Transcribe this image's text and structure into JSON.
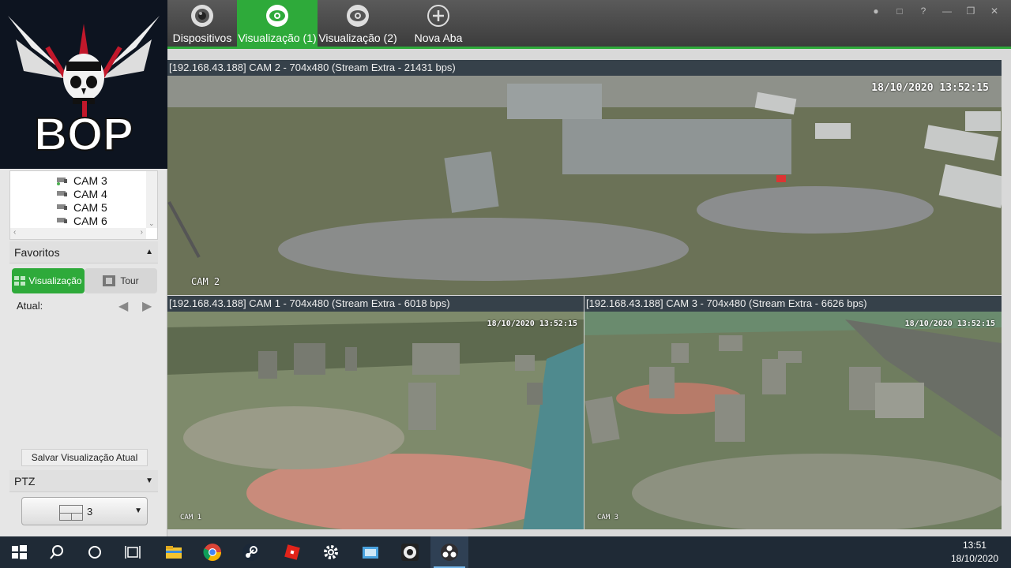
{
  "toolbar": {
    "tabs": [
      {
        "label": "Dispositivos",
        "icon": "camera-lens-icon"
      },
      {
        "label": "Visualização (1)",
        "icon": "eye-icon",
        "active": true
      },
      {
        "label": "Visualização (2)",
        "icon": "eye-icon"
      },
      {
        "label": "Nova Aba",
        "icon": "plus-circle-icon"
      }
    ],
    "window_controls": [
      "user-icon",
      "lock-icon",
      "help-icon",
      "minimize-icon",
      "restore-icon",
      "close-icon"
    ],
    "accent_color": "#2eaa3a"
  },
  "logo": {
    "text": "BOP"
  },
  "device_tree": {
    "items": [
      "CAM 3",
      "CAM 4",
      "CAM 5",
      "CAM 6"
    ]
  },
  "favoritos": {
    "label": "Favoritos",
    "view_button": "Visualização",
    "tour_button": "Tour",
    "current_label": "Atual:",
    "save_button": "Salvar Visualização Atual"
  },
  "ptz": {
    "label": "PTZ"
  },
  "layout_selector": {
    "value": "3"
  },
  "panes": [
    {
      "title": "[192.168.43.188] CAM 2 - 704x480 (Stream Extra - 21431 bps)",
      "osd_date": "18/10/2020  13:52:15",
      "osd_name": "CAM 2"
    },
    {
      "title": "[192.168.43.188] CAM 1 - 704x480 (Stream Extra - 6018 bps)",
      "osd_date": "18/10/2020  13:52:15",
      "osd_name": "CAM 1"
    },
    {
      "title": "[192.168.43.188] CAM 3 - 704x480 (Stream Extra - 6626 bps)",
      "osd_date": "18/10/2020  13:52:15",
      "osd_name": "CAM 3"
    }
  ],
  "taskbar": {
    "apps": [
      "windows-start-icon",
      "search-icon",
      "cortana-icon",
      "task-view-icon",
      "file-explorer-icon",
      "chrome-icon",
      "steam-icon",
      "roblox-icon",
      "settings-icon",
      "control-panel-icon",
      "obs-icon",
      "obs-studio-icon"
    ],
    "time": "13:51",
    "date": "18/10/2020"
  }
}
